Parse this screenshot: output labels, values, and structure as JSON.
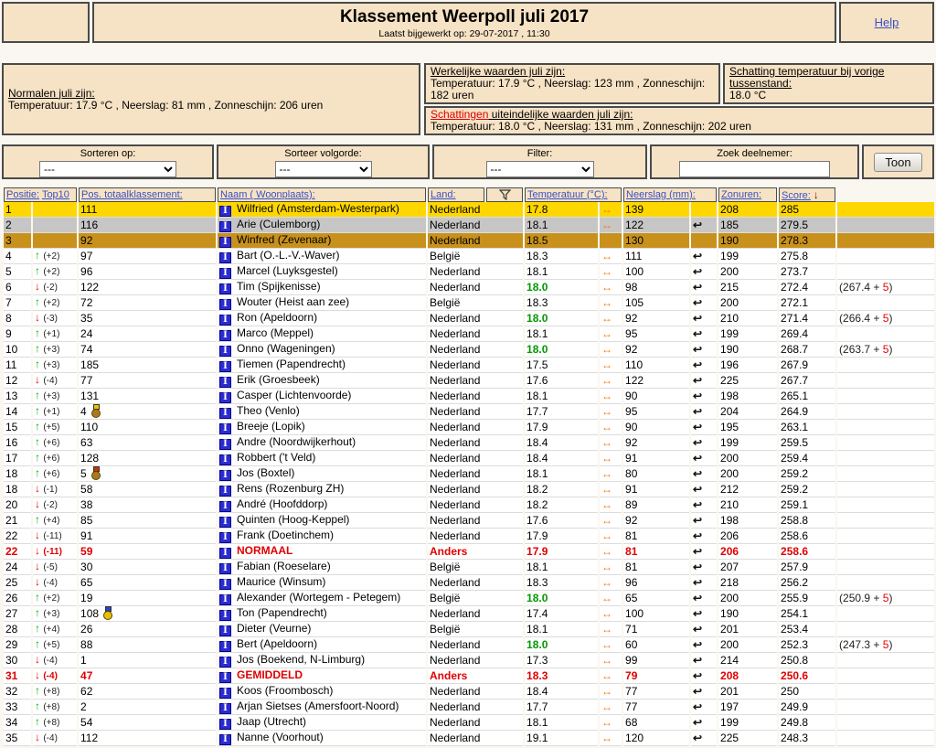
{
  "header": {
    "title": "Klassement Weerpoll juli 2017",
    "subtitle": "Laatst bijgewerkt op: 29-07-2017 , 11:30",
    "help_label": "Help"
  },
  "info_boxes": {
    "normalen": {
      "title": "Normalen juli zijn:",
      "values": "Temperatuur: 17.9 °C , Neerslag: 81 mm , Zonneschijn: 206 uren"
    },
    "werkelijke": {
      "title": "Werkelijke waarden juli zijn:",
      "values": "Temperatuur: 17.9 °C , Neerslag: 123 mm , Zonneschijn: 182 uren"
    },
    "schatting_vorige": {
      "title": "Schatting temperatuur bij vorige tussenstand:",
      "value": "18.0 °C"
    },
    "schattingen": {
      "title_red": "Schattingen",
      "title_rest": " uiteindelijke waarden juli zijn:",
      "values": "Temperatuur: 18.0 °C , Neerslag: 131 mm , Zonneschijn: 202 uren"
    }
  },
  "controls": {
    "sorteren_op": {
      "label": "Sorteren op:",
      "value": "---"
    },
    "sorteer_volgorde": {
      "label": "Sorteer volgorde:",
      "value": "---"
    },
    "filter": {
      "label": "Filter:",
      "value": "---"
    },
    "zoek": {
      "label": "Zoek deelnemer:",
      "value": ""
    },
    "toon_label": "Toon"
  },
  "icons": {
    "participant_glyph": "I",
    "temp_trend": "↔",
    "neerslag_trend": "↩",
    "up_arrow": "↑",
    "down_arrow": "↓",
    "score_sort_arrow": "↓"
  },
  "colors": {
    "box_bg": "#F6E2C4",
    "gold_row": "#FFD700",
    "silver_row": "#C6C6C6",
    "bronze_row": "#C8911B",
    "red_text": "#E00000",
    "green_temp": "#009900",
    "orange_trend": "#FF7700",
    "link_blue": "#3951C6"
  },
  "table": {
    "headers": {
      "positie": "Positie:",
      "top10": "Top10",
      "pos_total": "Pos. totaalklassement:",
      "naam": "Naam ( Woonplaats):",
      "land": "Land:",
      "temp": "Temperatuur (°C):",
      "neerslag": "Neerslag (mm):",
      "zonuren": "Zonuren:",
      "score": "Score:"
    },
    "rows": [
      {
        "pos": "1",
        "dir": null,
        "delta": "",
        "pos_total": "111",
        "medal": null,
        "name": "Wilfried (Amsterdam-Westerpark)",
        "land": "Nederland",
        "temp": "17.8",
        "temp_green": false,
        "neerslag": "139",
        "neerslag_icon": false,
        "zonuren": "208",
        "score": "285",
        "extra": null,
        "style": "gold"
      },
      {
        "pos": "2",
        "dir": null,
        "delta": "",
        "pos_total": "116",
        "medal": null,
        "name": "Arie (Culemborg)",
        "land": "Nederland",
        "temp": "18.1",
        "temp_green": false,
        "neerslag": "122",
        "neerslag_icon": true,
        "zonuren": "185",
        "score": "279.5",
        "extra": null,
        "style": "silver"
      },
      {
        "pos": "3",
        "dir": null,
        "delta": "",
        "pos_total": "92",
        "medal": null,
        "name": "Winfred (Zevenaar)",
        "land": "Nederland",
        "temp": "18.5",
        "temp_green": false,
        "neerslag": "130",
        "neerslag_icon": false,
        "zonuren": "190",
        "score": "278.3",
        "extra": null,
        "style": "bronze"
      },
      {
        "pos": "4",
        "dir": "up",
        "delta": "(+2)",
        "pos_total": "97",
        "medal": null,
        "name": "Bart (O.-L.-V.-Waver)",
        "land": "België",
        "temp": "18.3",
        "temp_green": false,
        "neerslag": "111",
        "neerslag_icon": true,
        "zonuren": "199",
        "score": "275.8",
        "extra": null,
        "style": "normal"
      },
      {
        "pos": "5",
        "dir": "up",
        "delta": "(+2)",
        "pos_total": "96",
        "medal": null,
        "name": "Marcel (Luyksgestel)",
        "land": "Nederland",
        "temp": "18.1",
        "temp_green": false,
        "neerslag": "100",
        "neerslag_icon": true,
        "zonuren": "200",
        "score": "273.7",
        "extra": null,
        "style": "normal"
      },
      {
        "pos": "6",
        "dir": "down",
        "delta": "(-2)",
        "pos_total": "122",
        "medal": null,
        "name": "Tim (Spijkenisse)",
        "land": "Nederland",
        "temp": "18.0",
        "temp_green": true,
        "neerslag": "98",
        "neerslag_icon": true,
        "zonuren": "215",
        "score": "272.4",
        "extra": {
          "base": "267.4",
          "bonus": "5"
        },
        "style": "normal"
      },
      {
        "pos": "7",
        "dir": "up",
        "delta": "(+2)",
        "pos_total": "72",
        "medal": null,
        "name": "Wouter (Heist aan zee)",
        "land": "België",
        "temp": "18.3",
        "temp_green": false,
        "neerslag": "105",
        "neerslag_icon": true,
        "zonuren": "200",
        "score": "272.1",
        "extra": null,
        "style": "normal"
      },
      {
        "pos": "8",
        "dir": "down",
        "delta": "(-3)",
        "pos_total": "35",
        "medal": null,
        "name": "Ron (Apeldoorn)",
        "land": "Nederland",
        "temp": "18.0",
        "temp_green": true,
        "neerslag": "92",
        "neerslag_icon": true,
        "zonuren": "210",
        "score": "271.4",
        "extra": {
          "base": "266.4",
          "bonus": "5"
        },
        "style": "normal"
      },
      {
        "pos": "9",
        "dir": "up",
        "delta": "(+1)",
        "pos_total": "24",
        "medal": null,
        "name": "Marco (Meppel)",
        "land": "Nederland",
        "temp": "18.1",
        "temp_green": false,
        "neerslag": "95",
        "neerslag_icon": true,
        "zonuren": "199",
        "score": "269.4",
        "extra": null,
        "style": "normal"
      },
      {
        "pos": "10",
        "dir": "up",
        "delta": "(+3)",
        "pos_total": "74",
        "medal": null,
        "name": "Onno (Wageningen)",
        "land": "Nederland",
        "temp": "18.0",
        "temp_green": true,
        "neerslag": "92",
        "neerslag_icon": true,
        "zonuren": "190",
        "score": "268.7",
        "extra": {
          "base": "263.7",
          "bonus": "5"
        },
        "style": "normal"
      },
      {
        "pos": "11",
        "dir": "up",
        "delta": "(+3)",
        "pos_total": "185",
        "medal": null,
        "name": "Tiemen (Papendrecht)",
        "land": "Nederland",
        "temp": "17.5",
        "temp_green": false,
        "neerslag": "110",
        "neerslag_icon": true,
        "zonuren": "196",
        "score": "267.9",
        "extra": null,
        "style": "normal"
      },
      {
        "pos": "12",
        "dir": "down",
        "delta": "(-4)",
        "pos_total": "77",
        "medal": null,
        "name": "Erik (Groesbeek)",
        "land": "Nederland",
        "temp": "17.6",
        "temp_green": false,
        "neerslag": "122",
        "neerslag_icon": true,
        "zonuren": "225",
        "score": "267.7",
        "extra": null,
        "style": "normal"
      },
      {
        "pos": "13",
        "dir": "up",
        "delta": "(+3)",
        "pos_total": "131",
        "medal": null,
        "name": "Casper (Lichtenvoorde)",
        "land": "Nederland",
        "temp": "18.1",
        "temp_green": false,
        "neerslag": "90",
        "neerslag_icon": true,
        "zonuren": "198",
        "score": "265.1",
        "extra": null,
        "style": "normal"
      },
      {
        "pos": "14",
        "dir": "up",
        "delta": "(+1)",
        "pos_total": "4",
        "medal": {
          "ribbon": "#EFC000",
          "disc": "#A97B1E"
        },
        "name": "Theo (Venlo)",
        "land": "Nederland",
        "temp": "17.7",
        "temp_green": false,
        "neerslag": "95",
        "neerslag_icon": true,
        "zonuren": "204",
        "score": "264.9",
        "extra": null,
        "style": "normal"
      },
      {
        "pos": "15",
        "dir": "up",
        "delta": "(+5)",
        "pos_total": "110",
        "medal": null,
        "name": "Breeje (Lopik)",
        "land": "Nederland",
        "temp": "17.9",
        "temp_green": false,
        "neerslag": "90",
        "neerslag_icon": true,
        "zonuren": "195",
        "score": "263.1",
        "extra": null,
        "style": "normal"
      },
      {
        "pos": "16",
        "dir": "up",
        "delta": "(+6)",
        "pos_total": "63",
        "medal": null,
        "name": "Andre (Noordwijkerhout)",
        "land": "Nederland",
        "temp": "18.4",
        "temp_green": false,
        "neerslag": "92",
        "neerslag_icon": true,
        "zonuren": "199",
        "score": "259.5",
        "extra": null,
        "style": "normal"
      },
      {
        "pos": "17",
        "dir": "up",
        "delta": "(+6)",
        "pos_total": "128",
        "medal": null,
        "name": "Robbert ('t Veld)",
        "land": "Nederland",
        "temp": "18.4",
        "temp_green": false,
        "neerslag": "91",
        "neerslag_icon": true,
        "zonuren": "200",
        "score": "259.4",
        "extra": null,
        "style": "normal"
      },
      {
        "pos": "18",
        "dir": "up",
        "delta": "(+6)",
        "pos_total": "5",
        "medal": {
          "ribbon": "#D33000",
          "disc": "#A97B1E"
        },
        "name": "Jos (Boxtel)",
        "land": "Nederland",
        "temp": "18.1",
        "temp_green": false,
        "neerslag": "80",
        "neerslag_icon": true,
        "zonuren": "200",
        "score": "259.2",
        "extra": null,
        "style": "normal"
      },
      {
        "pos": "18",
        "dir": "down",
        "delta": "(-1)",
        "pos_total": "58",
        "medal": null,
        "name": "Rens (Rozenburg ZH)",
        "land": "Nederland",
        "temp": "18.2",
        "temp_green": false,
        "neerslag": "91",
        "neerslag_icon": true,
        "zonuren": "212",
        "score": "259.2",
        "extra": null,
        "style": "normal"
      },
      {
        "pos": "20",
        "dir": "down",
        "delta": "(-2)",
        "pos_total": "38",
        "medal": null,
        "name": "André (Hoofddorp)",
        "land": "Nederland",
        "temp": "18.2",
        "temp_green": false,
        "neerslag": "89",
        "neerslag_icon": true,
        "zonuren": "210",
        "score": "259.1",
        "extra": null,
        "style": "normal"
      },
      {
        "pos": "21",
        "dir": "up",
        "delta": "(+4)",
        "pos_total": "85",
        "medal": null,
        "name": "Quinten (Hoog-Keppel)",
        "land": "Nederland",
        "temp": "17.6",
        "temp_green": false,
        "neerslag": "92",
        "neerslag_icon": true,
        "zonuren": "198",
        "score": "258.8",
        "extra": null,
        "style": "normal"
      },
      {
        "pos": "22",
        "dir": "down",
        "delta": "(-11)",
        "pos_total": "91",
        "medal": null,
        "name": "Frank (Doetinchem)",
        "land": "Nederland",
        "temp": "17.9",
        "temp_green": false,
        "neerslag": "81",
        "neerslag_icon": true,
        "zonuren": "206",
        "score": "258.6",
        "extra": null,
        "style": "normal"
      },
      {
        "pos": "22",
        "dir": "down",
        "delta": "(-11)",
        "pos_total": "59",
        "medal": null,
        "name": "NORMAAL",
        "land": "Anders",
        "temp": "17.9",
        "temp_green": false,
        "neerslag": "81",
        "neerslag_icon": true,
        "zonuren": "206",
        "score": "258.6",
        "extra": null,
        "style": "red"
      },
      {
        "pos": "24",
        "dir": "down",
        "delta": "(-5)",
        "pos_total": "30",
        "medal": null,
        "name": "Fabian (Roeselare)",
        "land": "België",
        "temp": "18.1",
        "temp_green": false,
        "neerslag": "81",
        "neerslag_icon": true,
        "zonuren": "207",
        "score": "257.9",
        "extra": null,
        "style": "normal"
      },
      {
        "pos": "25",
        "dir": "down",
        "delta": "(-4)",
        "pos_total": "65",
        "medal": null,
        "name": "Maurice (Winsum)",
        "land": "Nederland",
        "temp": "18.3",
        "temp_green": false,
        "neerslag": "96",
        "neerslag_icon": true,
        "zonuren": "218",
        "score": "256.2",
        "extra": null,
        "style": "normal"
      },
      {
        "pos": "26",
        "dir": "up",
        "delta": "(+2)",
        "pos_total": "19",
        "medal": null,
        "name": "Alexander (Wortegem - Petegem)",
        "land": "België",
        "temp": "18.0",
        "temp_green": true,
        "neerslag": "65",
        "neerslag_icon": true,
        "zonuren": "200",
        "score": "255.9",
        "extra": {
          "base": "250.9",
          "bonus": "5"
        },
        "style": "normal"
      },
      {
        "pos": "27",
        "dir": "up",
        "delta": "(+3)",
        "pos_total": "108",
        "medal": {
          "ribbon": "#2745C8",
          "disc": "#E8C000"
        },
        "name": "Ton (Papendrecht)",
        "land": "Nederland",
        "temp": "17.4",
        "temp_green": false,
        "neerslag": "100",
        "neerslag_icon": true,
        "zonuren": "190",
        "score": "254.1",
        "extra": null,
        "style": "normal"
      },
      {
        "pos": "28",
        "dir": "up",
        "delta": "(+4)",
        "pos_total": "26",
        "medal": null,
        "name": "Dieter (Veurne)",
        "land": "België",
        "temp": "18.1",
        "temp_green": false,
        "neerslag": "71",
        "neerslag_icon": true,
        "zonuren": "201",
        "score": "253.4",
        "extra": null,
        "style": "normal"
      },
      {
        "pos": "29",
        "dir": "up",
        "delta": "(+5)",
        "pos_total": "88",
        "medal": null,
        "name": "Bert (Apeldoorn)",
        "land": "Nederland",
        "temp": "18.0",
        "temp_green": true,
        "neerslag": "60",
        "neerslag_icon": true,
        "zonuren": "200",
        "score": "252.3",
        "extra": {
          "base": "247.3",
          "bonus": "5"
        },
        "style": "normal"
      },
      {
        "pos": "30",
        "dir": "down",
        "delta": "(-4)",
        "pos_total": "1",
        "medal": null,
        "name": "Jos (Boekend, N-Limburg)",
        "land": "Nederland",
        "temp": "17.3",
        "temp_green": false,
        "neerslag": "99",
        "neerslag_icon": true,
        "zonuren": "214",
        "score": "250.8",
        "extra": null,
        "style": "normal"
      },
      {
        "pos": "31",
        "dir": "down",
        "delta": "(-4)",
        "pos_total": "47",
        "medal": null,
        "name": "GEMIDDELD",
        "land": "Anders",
        "temp": "18.3",
        "temp_green": false,
        "neerslag": "79",
        "neerslag_icon": true,
        "zonuren": "208",
        "score": "250.6",
        "extra": null,
        "style": "red"
      },
      {
        "pos": "32",
        "dir": "up",
        "delta": "(+8)",
        "pos_total": "62",
        "medal": null,
        "name": "Koos (Froombosch)",
        "land": "Nederland",
        "temp": "18.4",
        "temp_green": false,
        "neerslag": "77",
        "neerslag_icon": true,
        "zonuren": "201",
        "score": "250",
        "extra": null,
        "style": "normal"
      },
      {
        "pos": "33",
        "dir": "up",
        "delta": "(+8)",
        "pos_total": "2",
        "medal": null,
        "name": "Arjan Sietses (Amersfoort-Noord)",
        "land": "Nederland",
        "temp": "17.7",
        "temp_green": false,
        "neerslag": "77",
        "neerslag_icon": true,
        "zonuren": "197",
        "score": "249.9",
        "extra": null,
        "style": "normal"
      },
      {
        "pos": "34",
        "dir": "up",
        "delta": "(+8)",
        "pos_total": "54",
        "medal": null,
        "name": "Jaap (Utrecht)",
        "land": "Nederland",
        "temp": "18.1",
        "temp_green": false,
        "neerslag": "68",
        "neerslag_icon": true,
        "zonuren": "199",
        "score": "249.8",
        "extra": null,
        "style": "normal"
      },
      {
        "pos": "35",
        "dir": "down",
        "delta": "(-4)",
        "pos_total": "112",
        "medal": null,
        "name": "Nanne (Voorhout)",
        "land": "Nederland",
        "temp": "19.1",
        "temp_green": false,
        "neerslag": "120",
        "neerslag_icon": true,
        "zonuren": "225",
        "score": "248.3",
        "extra": null,
        "style": "normal"
      }
    ]
  }
}
